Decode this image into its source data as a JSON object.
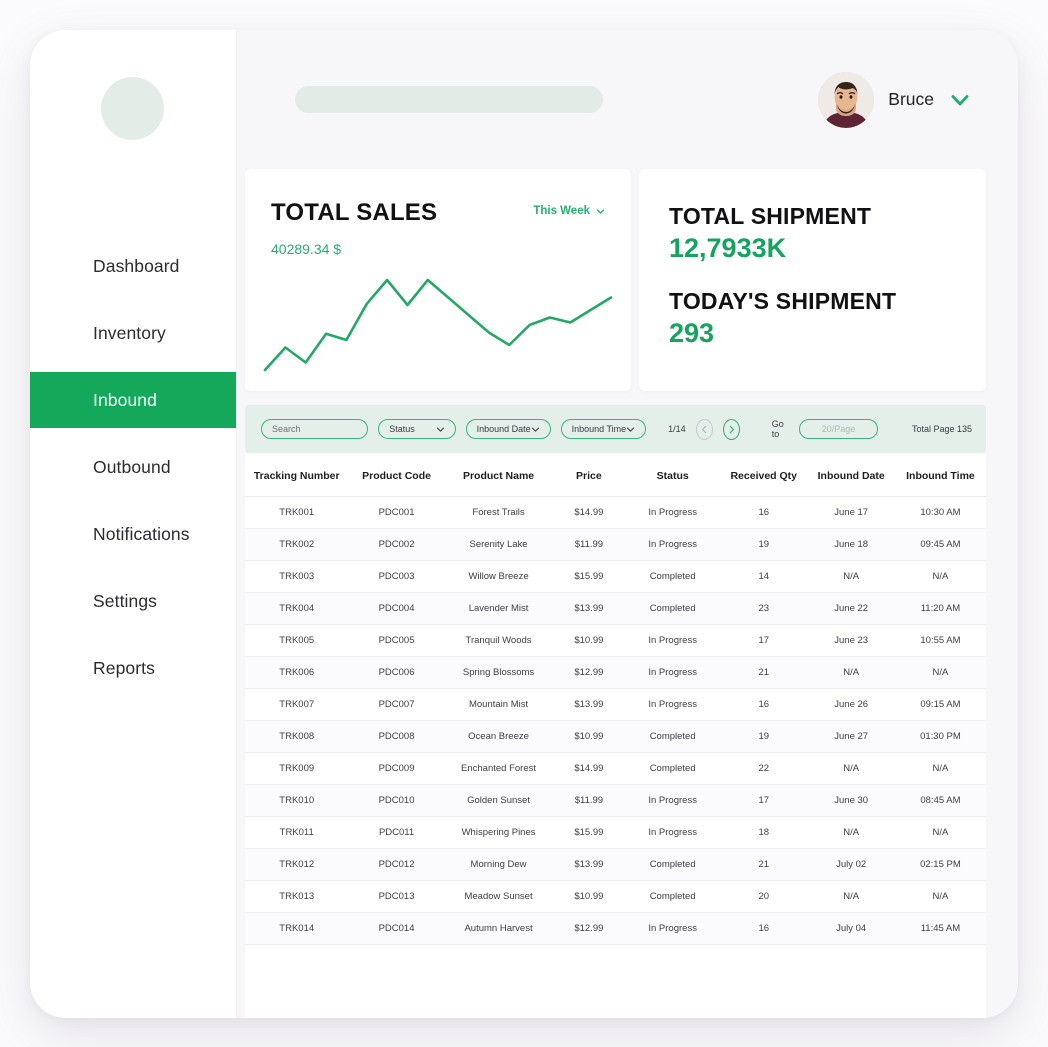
{
  "sidebar": {
    "logo_name": "app-logo",
    "items": [
      {
        "label": "Dashboard",
        "active": false
      },
      {
        "label": "Inventory",
        "active": false
      },
      {
        "label": "Inbound",
        "active": true
      },
      {
        "label": "Outbound",
        "active": false
      },
      {
        "label": "Notifications",
        "active": false
      },
      {
        "label": "Settings",
        "active": false
      },
      {
        "label": "Reports",
        "active": false
      }
    ]
  },
  "header": {
    "search_placeholder": "",
    "user_name": "Bruce",
    "chevron_icon": "chevron-down-icon",
    "avatar_icon": "user-avatar"
  },
  "sales_card": {
    "title": "TOTAL SALES",
    "range_label": "This Week",
    "range_caret": "chevron-down-icon",
    "value": "40289.34 $"
  },
  "shipment_card": {
    "total_title": "TOTAL SHIPMENT",
    "total_value": "12,7933K",
    "today_title": "TODAY'S SHIPMENT",
    "today_value": "293"
  },
  "toolbar": {
    "search_placeholder": "Search",
    "status_label": "Status",
    "inbound_date_label": "Inbound Date",
    "inbound_time_label": "Inbound Time",
    "page_indicator": "1/14",
    "prev_icon": "chevron-left-icon",
    "next_icon": "chevron-right-icon",
    "goto_label": "Go to",
    "goto_placeholder": "20/Page",
    "total_pages": "Total Page 135"
  },
  "table": {
    "columns": [
      "Tracking Number",
      "Product Code",
      "Product Name",
      "Price",
      "Status",
      "Received Qty",
      "Inbound Date",
      "Inbound Time"
    ],
    "rows": [
      {
        "tracking": "TRK001",
        "code": "PDC001",
        "name": "Forest Trails",
        "price": "$14.99",
        "status": "In Progress",
        "qty": "16",
        "date": "June 17",
        "time": "10:30 AM"
      },
      {
        "tracking": "TRK002",
        "code": "PDC002",
        "name": "Serenity Lake",
        "price": "$11.99",
        "status": "In Progress",
        "qty": "19",
        "date": "June 18",
        "time": "09:45 AM"
      },
      {
        "tracking": "TRK003",
        "code": "PDC003",
        "name": "Willow Breeze",
        "price": "$15.99",
        "status": "Completed",
        "qty": "14",
        "date": "N/A",
        "time": "N/A"
      },
      {
        "tracking": "TRK004",
        "code": "PDC004",
        "name": "Lavender Mist",
        "price": "$13.99",
        "status": "Completed",
        "qty": "23",
        "date": "June 22",
        "time": "11:20 AM"
      },
      {
        "tracking": "TRK005",
        "code": "PDC005",
        "name": "Tranquil Woods",
        "price": "$10.99",
        "status": "In Progress",
        "qty": "17",
        "date": "June 23",
        "time": "10:55 AM"
      },
      {
        "tracking": "TRK006",
        "code": "PDC006",
        "name": "Spring Blossoms",
        "price": "$12.99",
        "status": "In Progress",
        "qty": "21",
        "date": "N/A",
        "time": "N/A"
      },
      {
        "tracking": "TRK007",
        "code": "PDC007",
        "name": "Mountain Mist",
        "price": "$13.99",
        "status": "In Progress",
        "qty": "16",
        "date": "June 26",
        "time": "09:15 AM"
      },
      {
        "tracking": "TRK008",
        "code": "PDC008",
        "name": "Ocean Breeze",
        "price": "$10.99",
        "status": "Completed",
        "qty": "19",
        "date": "June 27",
        "time": "01:30 PM"
      },
      {
        "tracking": "TRK009",
        "code": "PDC009",
        "name": "Enchanted Forest",
        "price": "$14.99",
        "status": "Completed",
        "qty": "22",
        "date": "N/A",
        "time": "N/A"
      },
      {
        "tracking": "TRK010",
        "code": "PDC010",
        "name": "Golden Sunset",
        "price": "$11.99",
        "status": "In Progress",
        "qty": "17",
        "date": "June 30",
        "time": "08:45 AM"
      },
      {
        "tracking": "TRK011",
        "code": "PDC011",
        "name": "Whispering Pines",
        "price": "$15.99",
        "status": "In Progress",
        "qty": "18",
        "date": "N/A",
        "time": "N/A"
      },
      {
        "tracking": "TRK012",
        "code": "PDC012",
        "name": "Morning Dew",
        "price": "$13.99",
        "status": "Completed",
        "qty": "21",
        "date": "July 02",
        "time": "02:15 PM"
      },
      {
        "tracking": "TRK013",
        "code": "PDC013",
        "name": "Meadow Sunset",
        "price": "$10.99",
        "status": "Completed",
        "qty": "20",
        "date": "N/A",
        "time": "N/A"
      },
      {
        "tracking": "TRK014",
        "code": "PDC014",
        "name": "Autumn Harvest",
        "price": "$12.99",
        "status": "In Progress",
        "qty": "16",
        "date": "July 04",
        "time": "11:45 AM"
      }
    ]
  },
  "chart_data": {
    "type": "line",
    "title": "TOTAL SALES",
    "series_name": "This Week",
    "x": [
      0,
      1,
      2,
      3,
      4,
      5,
      6,
      7,
      8,
      9,
      10,
      11,
      12,
      13,
      14,
      15,
      16,
      17
    ],
    "values": [
      4,
      22,
      10,
      33,
      28,
      57,
      76,
      56,
      76,
      62,
      48,
      34,
      24,
      40,
      46,
      42,
      52,
      62
    ],
    "ylim": [
      0,
      80
    ],
    "grid": false,
    "legend": "none",
    "line_color": "#23a866"
  },
  "colors": {
    "accent_green": "#14a85a",
    "value_green": "#17a35f",
    "status_progress": "#ef9033",
    "status_completed": "#27ae60",
    "toolbar_bg": "#e4efe9"
  }
}
